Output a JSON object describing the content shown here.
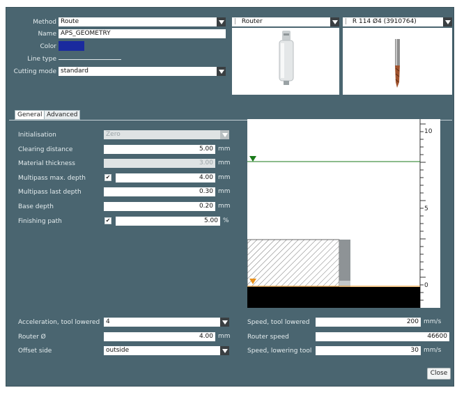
{
  "top": {
    "method": {
      "label": "Method",
      "value": "Route"
    },
    "name": {
      "label": "Name",
      "value": "APS_GEOMETRY"
    },
    "color": {
      "label": "Color",
      "swatch": "#1a2a9e"
    },
    "line_type": {
      "label": "Line type"
    },
    "cutting_mode": {
      "label": "Cutting mode",
      "value": "standard"
    },
    "router_select": {
      "value": "Router"
    },
    "bit_select": {
      "value": "R 114 Ø4 (3910764)"
    }
  },
  "tabs": [
    {
      "label": "General",
      "active": true
    },
    {
      "label": "Advanced",
      "active": false
    }
  ],
  "params": {
    "initialisation": {
      "label": "Initialisation",
      "value": "Zero"
    },
    "clearing_distance": {
      "label": "Clearing distance",
      "value": "5.00",
      "unit": "mm"
    },
    "material_thickness": {
      "label": "Material thickness",
      "value": "3.00",
      "unit": "mm"
    },
    "multipass_max_depth": {
      "label": "Multipass max. depth",
      "value": "4.00",
      "unit": "mm",
      "checked": true
    },
    "multipass_last_depth": {
      "label": "Multipass last depth",
      "value": "0.30",
      "unit": "mm"
    },
    "base_depth": {
      "label": "Base depth",
      "value": "0.20",
      "unit": "mm"
    },
    "finishing_path": {
      "label": "Finishing path",
      "value": "5.00",
      "unit": "%",
      "checked": true
    }
  },
  "bottom_left": {
    "acceleration": {
      "label": "Acceleration, tool lowered",
      "value": "4"
    },
    "router_diameter": {
      "label": "Router Ø",
      "value": "4.00",
      "unit": "mm"
    },
    "offset_side": {
      "label": "Offset side",
      "value": "outside"
    }
  },
  "bottom_right": {
    "speed_tool_lowered": {
      "label": "Speed, tool lowered",
      "value": "200",
      "unit": "mm/s"
    },
    "router_speed": {
      "label": "Router speed",
      "value": "46600"
    },
    "speed_lowering_tool": {
      "label": "Speed, lowering tool",
      "value": "30",
      "unit": "mm/s"
    }
  },
  "preview": {
    "scale_labels": [
      "10",
      "5",
      "0"
    ],
    "colors": {
      "top_marker": "#1a7a1a",
      "bottom_marker": "#e8901a",
      "material": "#000000"
    }
  },
  "close_label": "Close"
}
